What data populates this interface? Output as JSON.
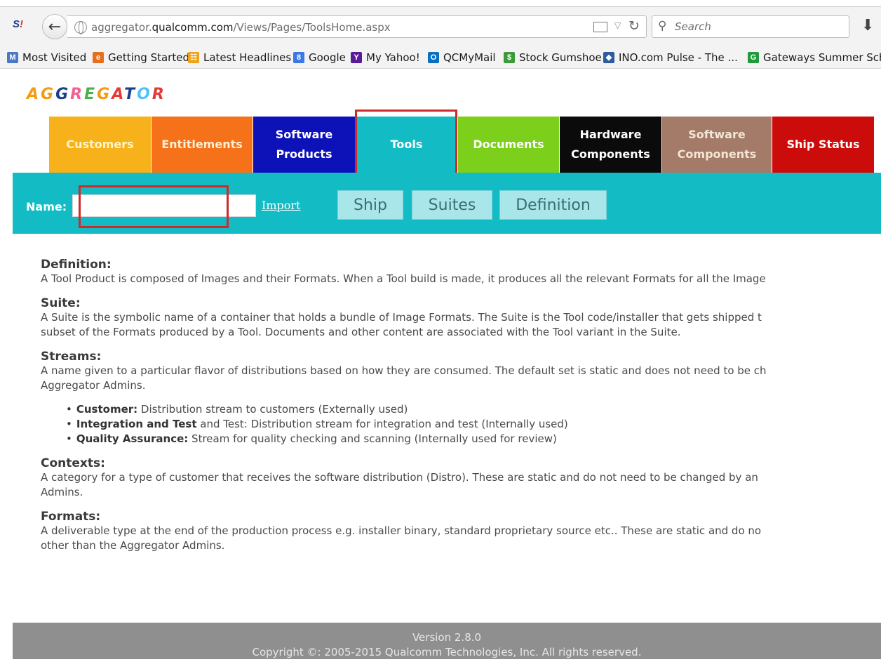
{
  "browser": {
    "url_prefix": "aggregator.",
    "url_domain": "qualcomm.com",
    "url_path": "/Views/Pages/ToolsHome.aspx",
    "search_placeholder": "Search",
    "bookmarks": [
      {
        "label": "Most Visited",
        "icon": "most-visited-icon",
        "color": "#4a78c6"
      },
      {
        "label": "Getting Started",
        "icon": "firefox-icon",
        "color": "#e2701f"
      },
      {
        "label": "Latest Headlines",
        "icon": "rss-icon",
        "color": "#f0a21a"
      },
      {
        "label": "Google",
        "icon": "google-icon",
        "color": "#3b78e7"
      },
      {
        "label": "My Yahoo!",
        "icon": "yahoo-icon",
        "color": "#5a1b9a"
      },
      {
        "label": "QCMyMail",
        "icon": "outlook-icon",
        "color": "#0b6fc1"
      },
      {
        "label": "Stock Gumshoe",
        "icon": "dollar-icon",
        "color": "#3d9a3a"
      },
      {
        "label": "INO.com Pulse - The ...",
        "icon": "ino-icon",
        "color": "#2b5c9e"
      },
      {
        "label": "Gateways Summer Sch...",
        "icon": "gateways-icon",
        "color": "#1f9a3c"
      }
    ]
  },
  "app": {
    "logo_letters": [
      {
        "ch": "A",
        "color": "#f39c12"
      },
      {
        "ch": "G",
        "color": "#f39c12"
      },
      {
        "ch": "G",
        "color": "#1a3f8f"
      },
      {
        "ch": "R",
        "color": "#f06292"
      },
      {
        "ch": "E",
        "color": "#4caf50"
      },
      {
        "ch": "G",
        "color": "#f39c12"
      },
      {
        "ch": "A",
        "color": "#e53935"
      },
      {
        "ch": "T",
        "color": "#1a3f8f"
      },
      {
        "ch": "O",
        "color": "#4fc3f7"
      },
      {
        "ch": "R",
        "color": "#e53935"
      }
    ],
    "tabs": [
      {
        "label": "Customers",
        "bg": "#f7b21b",
        "fg": "#fff7c8"
      },
      {
        "label": "Entitlements",
        "bg": "#f5721b",
        "fg": "#fff1d6"
      },
      {
        "label": "Software\nProducts",
        "bg": "#0d12b8",
        "fg": "#ffffff"
      },
      {
        "label": "Tools",
        "bg": "#13bcc5",
        "fg": "#ffffff"
      },
      {
        "label": "Documents",
        "bg": "#7ccf1b",
        "fg": "#ffffff"
      },
      {
        "label": "Hardware\nComponents",
        "bg": "#0b0b0b",
        "fg": "#ffffff"
      },
      {
        "label": "Software\nComponents",
        "bg": "#a47a68",
        "fg": "#f3e6d6"
      },
      {
        "label": "Ship Status",
        "bg": "#cc0b0b",
        "fg": "#ffffff"
      }
    ],
    "toolbar": {
      "name_label": "Name:",
      "name_value": "",
      "import_label": "Import",
      "buttons": [
        "Ship",
        "Suites",
        "Definition"
      ]
    },
    "sections": [
      {
        "title": "Definition:",
        "lines": [
          "A Tool Product is composed of Images and their Formats. When a Tool build is made, it produces all the relevant Formats for all the Image"
        ]
      },
      {
        "title": "Suite:",
        "lines": [
          "A Suite is the symbolic name of a container that holds a bundle of Image Formats. The Suite is the Tool code/installer that gets shipped t",
          "subset of the Formats produced by a Tool. Documents and other content are associated with the Tool variant in the Suite."
        ]
      },
      {
        "title": "Streams:",
        "lines": [
          "A name given to a particular flavor of distributions based on how they are consumed. The default set is static and does not need to be ch",
          "Aggregator Admins."
        ]
      },
      {
        "title": "Contexts:",
        "lines": [
          "A category for a type of customer that receives the software distribution (Distro). These are static and do not need to be changed by an",
          "Admins."
        ]
      },
      {
        "title": "Formats:",
        "lines": [
          "A deliverable type at the end of the production process e.g. installer binary, standard proprietary source etc.. These are static and do no",
          "other than the Aggregator Admins."
        ]
      }
    ],
    "streams": [
      {
        "term": "Customer:",
        "text": " Distribution stream to customers (Externally used)"
      },
      {
        "term": "Integration and Test",
        "text": " and Test: Distribution stream for integration and test (Internally used)"
      },
      {
        "term": "Quality Assurance:",
        "text": " Stream for quality checking and scanning (Internally used for review)"
      }
    ],
    "footer": {
      "version": "Version 2.8.0",
      "copyright": "Copyright ©: 2005-2015 Qualcomm Technologies, Inc. All rights reserved."
    }
  }
}
